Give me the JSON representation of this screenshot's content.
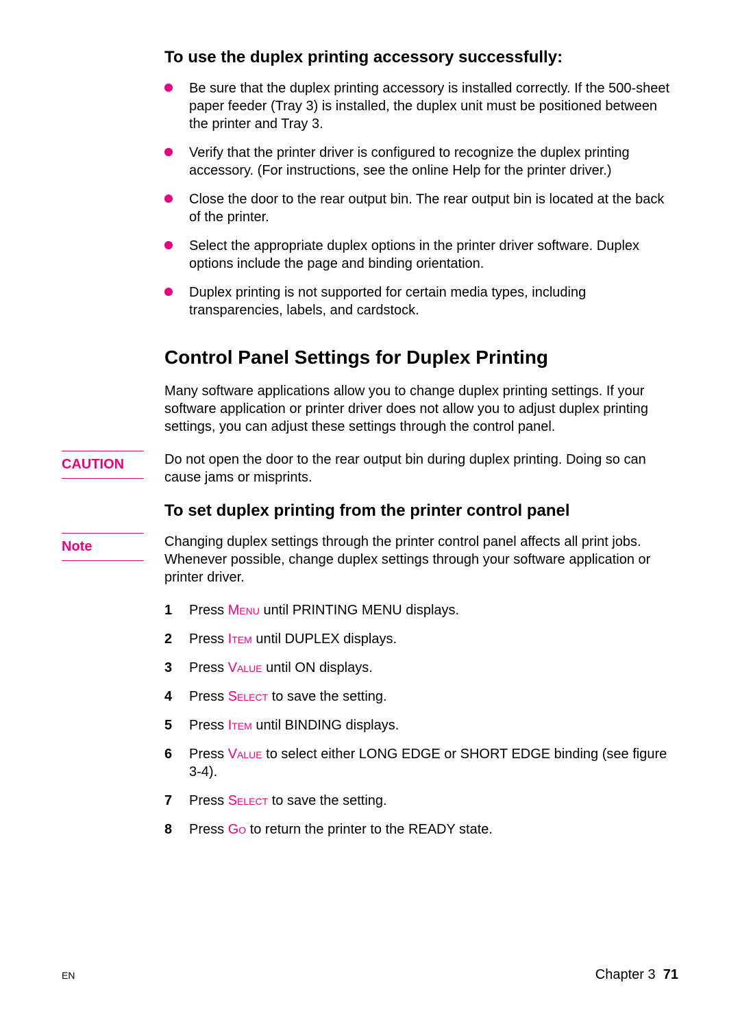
{
  "section1": {
    "heading": "To use the duplex printing accessory successfully:",
    "bullets": [
      "Be sure that the duplex printing accessory is installed correctly. If the 500-sheet paper feeder (Tray 3) is installed, the duplex unit must be positioned between the printer and Tray 3.",
      "Verify that the printer driver is configured to recognize the duplex printing accessory. (For instructions, see the online Help for the printer driver.)",
      "Close the door to the rear output bin. The rear output bin is located at the back of the printer.",
      "Select the appropriate duplex options in the printer driver software. Duplex options include the page and binding orientation.",
      "Duplex printing is not supported for certain media types, including transparencies, labels, and cardstock."
    ]
  },
  "section2": {
    "heading": "Control Panel Settings for Duplex Printing",
    "para": "Many software applications allow you to change duplex printing settings. If your software application or printer driver does not allow you to adjust duplex printing settings, you can adjust these settings through the control panel."
  },
  "caution": {
    "label": "CAUTION",
    "text": "Do not open the door to the rear output bin during duplex printing. Doing so can cause jams or misprints."
  },
  "section3": {
    "heading": "To set duplex printing from the printer control panel"
  },
  "note": {
    "label": "Note",
    "text": "Changing duplex settings through the printer control panel affects all print jobs. Whenever possible, change duplex settings through your software application or printer driver."
  },
  "steps": [
    {
      "pre": "Press ",
      "key": "Menu",
      "post": " until PRINTING MENU displays."
    },
    {
      "pre": "Press ",
      "key": "Item",
      "post": " until DUPLEX displays."
    },
    {
      "pre": "Press ",
      "key": "Value",
      "post": " until ON displays."
    },
    {
      "pre": "Press ",
      "key": "Select",
      "post": " to save the setting."
    },
    {
      "pre": "Press ",
      "key": "Item",
      "post": " until BINDING displays."
    },
    {
      "pre": "Press ",
      "key": "Value",
      "post": " to select either LONG EDGE or SHORT EDGE binding (see figure 3-4)."
    },
    {
      "pre": "Press ",
      "key": "Select",
      "post": " to save the setting."
    },
    {
      "pre": "Press ",
      "key": "Go",
      "post": " to return the printer to the READY state."
    }
  ],
  "footer": {
    "left": "EN",
    "chapter": "Chapter 3",
    "page": "71"
  }
}
